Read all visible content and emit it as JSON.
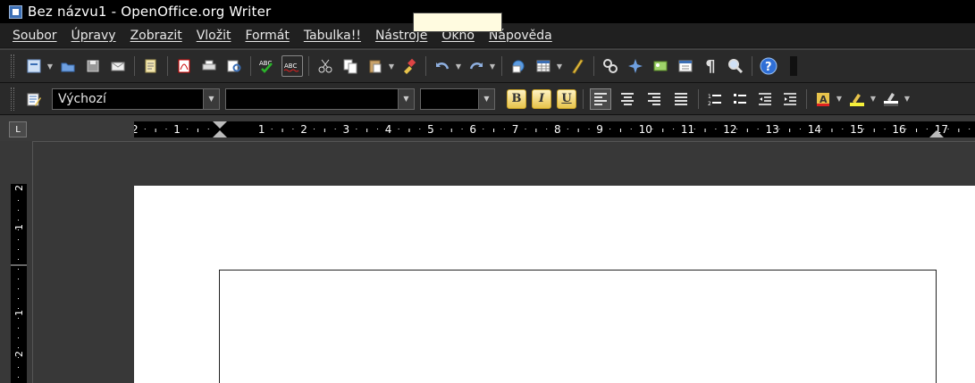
{
  "window": {
    "title": "Bez názvu1 - OpenOffice.org Writer"
  },
  "menu": [
    "Soubor",
    "Úpravy",
    "Zobrazit",
    "Vložit",
    "Formát",
    "Tabulka!!",
    "Nástroje",
    "Okno",
    "Nápověda"
  ],
  "toolbar_format": {
    "style": "Výchozí",
    "font": "",
    "size": "",
    "bold": "B",
    "italic": "I",
    "underline": "U"
  },
  "ruler": {
    "horizontal_labels": [
      "2",
      "1",
      "1",
      "2",
      "3",
      "4",
      "5",
      "6",
      "7",
      "8",
      "9",
      "10",
      "11",
      "12",
      "13",
      "14",
      "15",
      "16",
      "17"
    ],
    "vertical_labels": [
      "2",
      "1",
      "1",
      "2"
    ],
    "tab_selector": "L"
  },
  "colors": {
    "accent_yellow": "#e7c34b",
    "help_blue": "#2f6fd6"
  }
}
